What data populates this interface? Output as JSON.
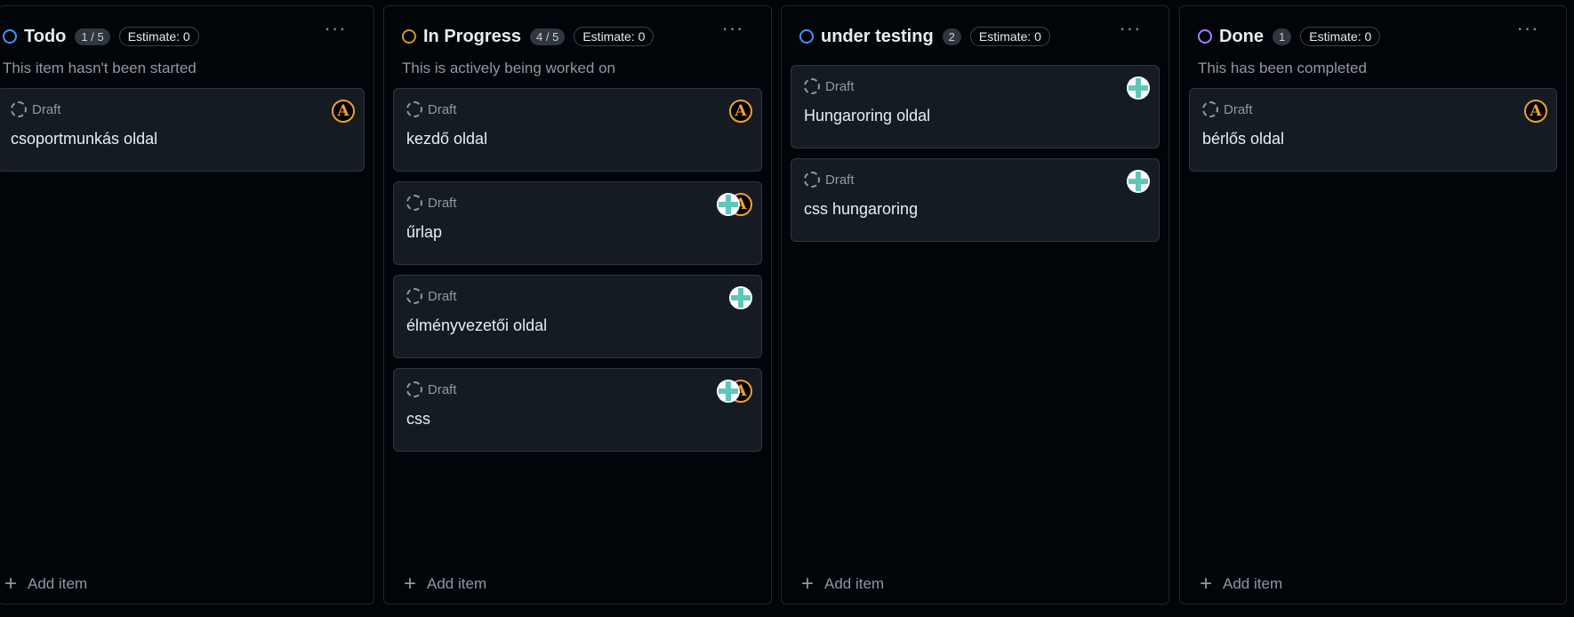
{
  "columns": [
    {
      "title": "Todo",
      "count": "1 / 5",
      "estimate": "Estimate: 0",
      "ring_color": "#4493f8",
      "description": "This item hasn't been started",
      "menu": "···",
      "add_item": "Add item",
      "cards": [
        {
          "status": "Draft",
          "title": "csoportmunkás oldal",
          "assignees": [
            "A"
          ]
        }
      ]
    },
    {
      "title": "In Progress",
      "count": "4 / 5",
      "estimate": "Estimate: 0",
      "ring_color": "#d29922",
      "description": "This is actively being worked on",
      "menu": "···",
      "add_item": "Add item",
      "cards": [
        {
          "status": "Draft",
          "title": "kezdő oldal",
          "assignees": [
            "A"
          ]
        },
        {
          "status": "Draft",
          "title": "űrlap",
          "assignees": [
            "A",
            "cross"
          ]
        },
        {
          "status": "Draft",
          "title": "élményvezetői oldal",
          "assignees": [
            "cross"
          ]
        },
        {
          "status": "Draft",
          "title": "css",
          "assignees": [
            "A",
            "cross"
          ]
        }
      ]
    },
    {
      "title": "under testing",
      "count": "2",
      "estimate": "Estimate: 0",
      "ring_color": "#4493f8",
      "description": "",
      "menu": "···",
      "add_item": "Add item",
      "cards": [
        {
          "status": "Draft",
          "title": "Hungaroring oldal",
          "assignees": [
            "cross"
          ]
        },
        {
          "status": "Draft",
          "title": "css hungaroring",
          "assignees": [
            "cross"
          ]
        }
      ]
    },
    {
      "title": "Done",
      "count": "1",
      "estimate": "Estimate: 0",
      "ring_color": "#ab7df8",
      "description": "This has been completed",
      "menu": "···",
      "add_item": "Add item",
      "cards": [
        {
          "status": "Draft",
          "title": "bérlős oldal",
          "assignees": [
            "A"
          ]
        }
      ]
    }
  ],
  "avatar_glyph": "A",
  "icons": {
    "status": "status-circle-icon",
    "draft": "draft-dashed-circle-icon",
    "menu": "kebab-menu-icon",
    "add": "plus-icon",
    "avatar_a": "avatar-letter-a-icon",
    "avatar_cross": "avatar-cross-icon"
  }
}
